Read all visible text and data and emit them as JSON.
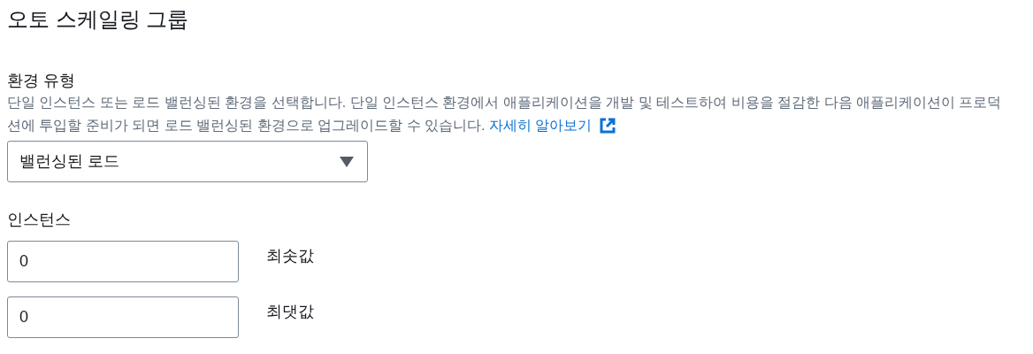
{
  "title": "오토 스케일링 그룹",
  "environment_type": {
    "label": "환경 유형",
    "description": "단일 인스턴스 또는 로드 밸런싱된 환경을 선택합니다. 단일 인스턴스 환경에서 애플리케이션을 개발 및 테스트하여 비용을 절감한 다음 애플리케이션이 프로덕션에 투입할 준비가 되면 로드 밸런싱된 환경으로 업그레이드할 수 있습니다.",
    "link": "자세히 알아보기",
    "select_value": "밸런싱된 로드"
  },
  "instances": {
    "label": "인스턴스",
    "fields": [
      {
        "value": "0",
        "label": "최솟값"
      },
      {
        "value": "0",
        "label": "최댓값"
      }
    ]
  }
}
